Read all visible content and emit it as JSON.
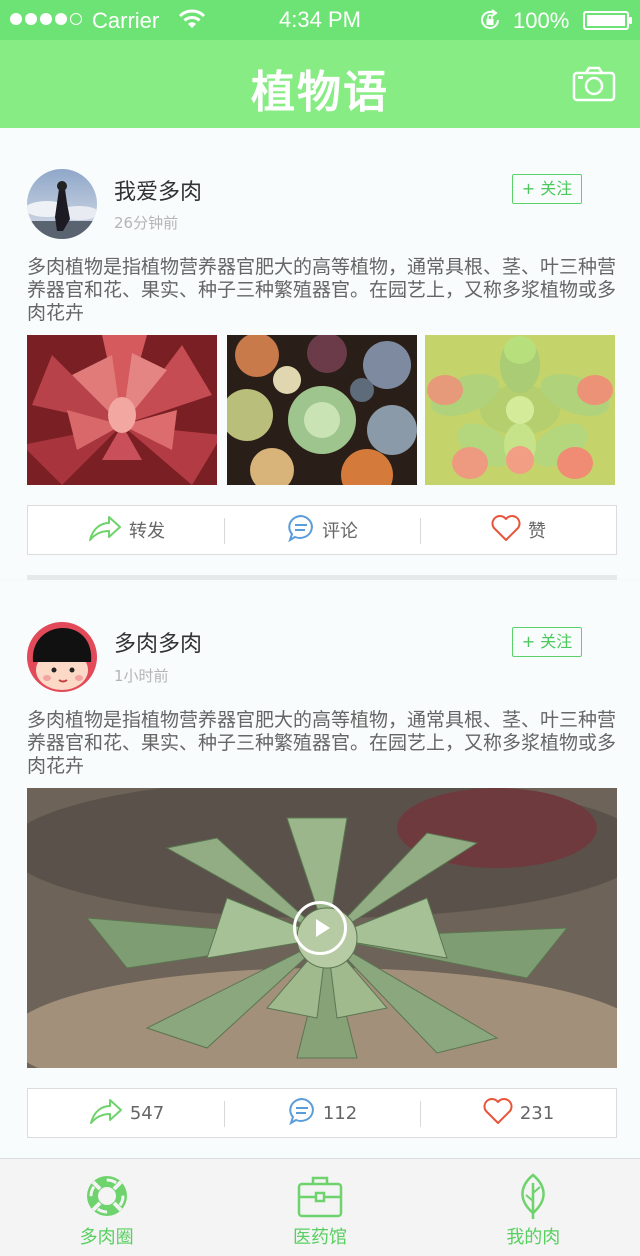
{
  "status_bar": {
    "carrier": "Carrier",
    "time": "4:34 PM",
    "battery": "100%"
  },
  "nav": {
    "title": "植物语",
    "camera_icon": "camera-icon"
  },
  "colors": {
    "accent": "#6ee375",
    "nav_bg": "#87ec84",
    "follow_green": "#4cc85c",
    "like_red": "#e8543a",
    "comment_blue": "#5b9ddb"
  },
  "posts": [
    {
      "user": "我爱多肉",
      "time": "26分钟前",
      "follow_label": "+ 关注",
      "text": "多肉植物是指植物营养器官肥大的高等植物，通常具根、茎、叶三种营养器官和花、果实、种子三种繁殖器官。在园艺上，又称多浆植物或多肉花卉",
      "actions": {
        "share": "转发",
        "comment": "评论",
        "like": "赞"
      }
    },
    {
      "user": "多肉多肉",
      "time": "1小时前",
      "follow_label": "+ 关注",
      "text": "多肉植物是指植物营养器官肥大的高等植物，通常具根、茎、叶三种营养器官和花、果实、种子三种繁殖器官。在园艺上，又称多浆植物或多肉花卉",
      "actions": {
        "share": "547",
        "comment": "112",
        "like": "231"
      }
    }
  ],
  "tabs": [
    {
      "label": "多肉圈",
      "icon": "lifebuoy-icon"
    },
    {
      "label": "医药馆",
      "icon": "medical-kit-icon"
    },
    {
      "label": "我的肉",
      "icon": "leaf-icon"
    }
  ]
}
